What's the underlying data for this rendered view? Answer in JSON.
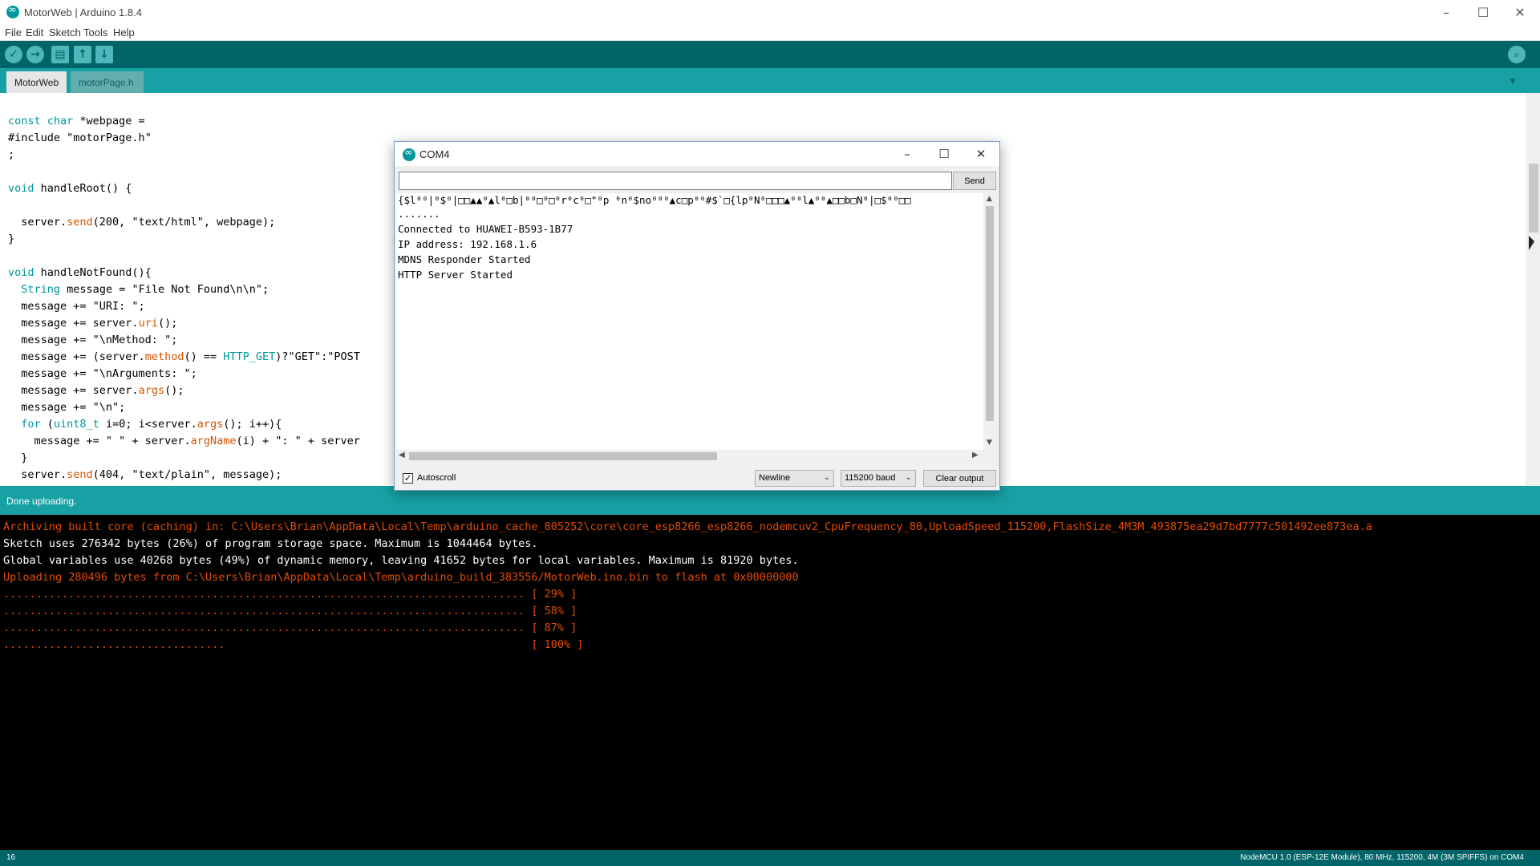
{
  "window": {
    "title": "MotorWeb | Arduino 1.8.4",
    "min_icon": "minimize-icon",
    "max_icon": "maximize-icon",
    "close_icon": "close-icon"
  },
  "menu": {
    "items": [
      "File",
      "Edit",
      "Sketch",
      "Tools",
      "Help"
    ]
  },
  "toolbar": {
    "verify_icon": "✓",
    "upload_icon": "→",
    "new_icon": "▤",
    "open_icon": "↑",
    "save_icon": "↓",
    "serial_icon": "⌕"
  },
  "tabs": [
    {
      "label": "MotorWeb",
      "active": true
    },
    {
      "label": "motorPage.h",
      "active": false
    }
  ],
  "tab_menu_icon": "▼",
  "editor": {
    "lines": [
      "const char *webpage =",
      "#include \"motorPage.h\"",
      ";",
      "",
      "void handleRoot() {",
      "",
      "  server.send(200, \"text/html\", webpage);",
      "}",
      "",
      "void handleNotFound(){",
      "  String message = \"File Not Found\\n\\n\";",
      "  message += \"URI: \";",
      "  message += server.uri();",
      "  message += \"\\nMethod: \";",
      "  message += (server.method() == HTTP_GET)?\"GET\":\"POST",
      "  message += \"\\nArguments: \";",
      "  message += server.args();",
      "  message += \"\\n\";",
      "  for (uint8_t i=0; i<server.args(); i++){",
      "    message += \" \" + server.argName(i) + \": \" + server",
      "  }",
      "  server.send(404, \"text/plain\", message);"
    ]
  },
  "status": {
    "message": "Done uploading."
  },
  "console": {
    "lines": [
      {
        "text": "Archiving built core (caching) in: C:\\Users\\Brian\\AppData\\Local\\Temp\\arduino_cache_805252\\core\\core_esp8266_esp8266_nodemcuv2_CpuFrequency_80,UploadSpeed_115200,FlashSize_4M3M_493875ea29d7bd7777c501492ee873ea.a",
        "color": "orange"
      },
      {
        "text": "Sketch uses 276342 bytes (26%) of program storage space. Maximum is 1044464 bytes.",
        "color": "white"
      },
      {
        "text": "Global variables use 40268 bytes (49%) of dynamic memory, leaving 41652 bytes for local variables. Maximum is 81920 bytes.",
        "color": "white"
      },
      {
        "text": "Uploading 280496 bytes from C:\\Users\\Brian\\AppData\\Local\\Temp\\arduino_build_383556/MotorWeb.ino.bin to flash at 0x00000000",
        "color": "orange"
      },
      {
        "text": "................................................................................ [ 29% ]",
        "color": "orange"
      },
      {
        "text": "................................................................................ [ 58% ]",
        "color": "orange"
      },
      {
        "text": "................................................................................ [ 87% ]",
        "color": "orange"
      },
      {
        "text": "..................................                                               [ 100% ]",
        "color": "orange"
      }
    ]
  },
  "bottom": {
    "line_number": "16",
    "board": "NodeMCU 1.0 (ESP-12E Module), 80 MHz, 115200, 4M (3M SPIFFS) on COM4"
  },
  "serial_monitor": {
    "title": "COM4",
    "input_value": "",
    "send_label": "Send",
    "output": [
      "{$l⁰⁰|⁰$⁰|□□▲▲⁰▲l⁰□b|⁰⁰□⁰□⁰r⁰c⁰□\"⁰p ⁰n⁰$no⁰⁰⁰▲c□p⁰⁰#$`□{lp⁰N⁰□□□▲⁰⁰l▲⁰⁰▲□□b□N⁰|□$⁰⁰□□",
      ".......",
      "Connected to HUAWEI-B593-1B77",
      "IP address: 192.168.1.6",
      "MDNS Responder Started",
      "HTTP Server Started"
    ],
    "autoscroll_label": "Autoscroll",
    "autoscroll_checked": true,
    "line_ending": "Newline",
    "baud": "115200 baud",
    "clear_label": "Clear output"
  },
  "colors": {
    "toolbar": "#006468",
    "tabbar": "#17a1a5",
    "console_bg": "#000000",
    "console_orange": "#e34c00"
  }
}
